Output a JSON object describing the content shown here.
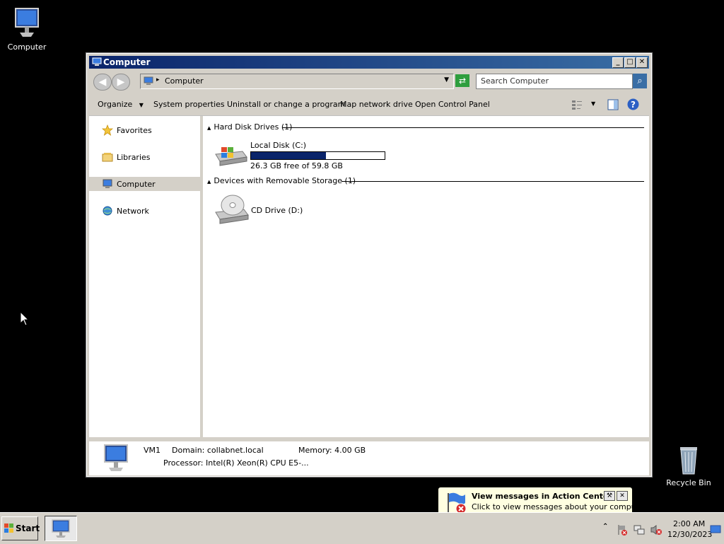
{
  "desktop": {
    "icons": [
      {
        "label": "Computer",
        "icon": "computer-icon"
      },
      {
        "label": "Recycle Bin",
        "icon": "recycle-bin-icon"
      }
    ]
  },
  "window": {
    "title": "Computer",
    "address": {
      "crumb": "Computer"
    },
    "search": {
      "placeholder": "Search Computer"
    },
    "commands": {
      "organize": "Organize",
      "system_properties": "System properties",
      "uninstall": "Uninstall or change a program",
      "map_drive": "Map network drive",
      "control_panel": "Open Control Panel"
    },
    "nav": [
      {
        "label": "Favorites",
        "icon": "star-icon"
      },
      {
        "label": "Libraries",
        "icon": "library-icon"
      },
      {
        "label": "Computer",
        "icon": "computer-icon",
        "selected": true
      },
      {
        "label": "Network",
        "icon": "network-icon"
      }
    ],
    "groups": {
      "hdd": {
        "header": "Hard Disk Drives (1)",
        "drive": {
          "name": "Local Disk (C:)",
          "free_text": "26.3 GB free of 59.8 GB",
          "used_fraction": 0.56
        }
      },
      "removable": {
        "header": "Devices with Removable Storage (1)",
        "drive": {
          "name": "CD Drive (D:)"
        }
      }
    },
    "details": {
      "name": "VM1",
      "domain": "Domain: collabnet.local",
      "memory": "Memory: 4.00 GB",
      "processor": "Processor: Intel(R) Xeon(R) CPU E5-..."
    }
  },
  "taskbar": {
    "start_label": "Start",
    "clock_time": "2:00 AM",
    "clock_date": "12/30/2023"
  },
  "balloon": {
    "title": "View messages in Action Center",
    "text": "Click to view messages about your computer."
  },
  "colors": {
    "titlebar": "#0a246a",
    "progress": "#0a246a",
    "desktop": "#000000"
  }
}
